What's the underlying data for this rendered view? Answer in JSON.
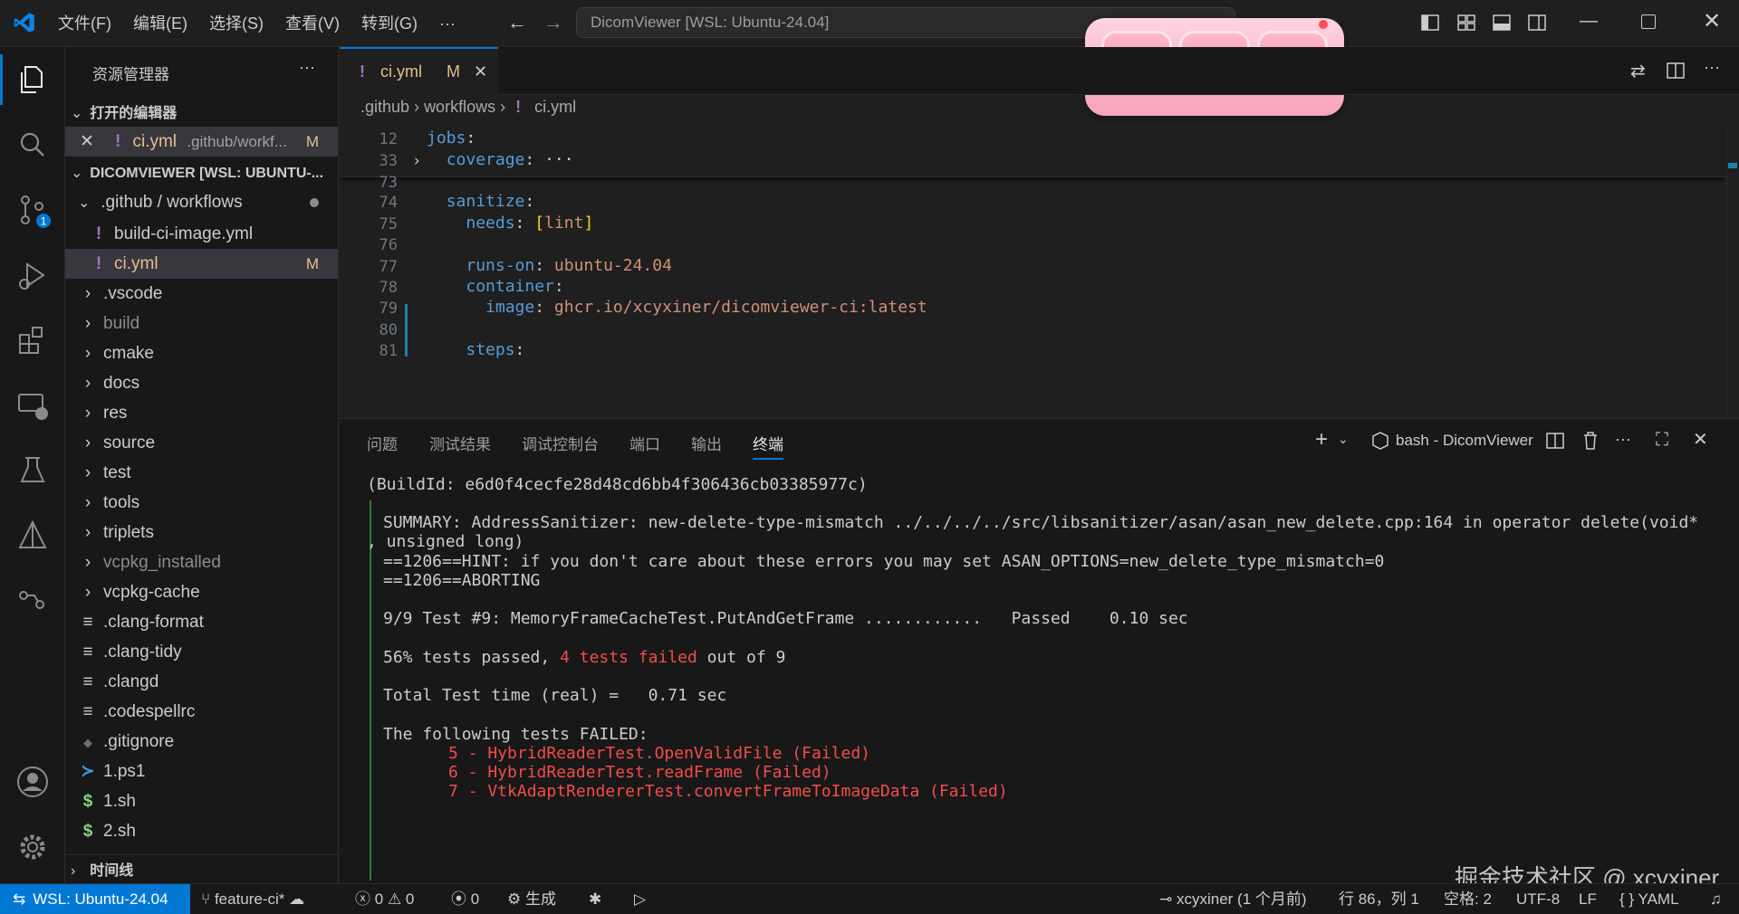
{
  "menu": [
    "文件(F)",
    "编辑(E)",
    "选择(S)",
    "查看(V)",
    "转到(G)",
    "···"
  ],
  "window_title": "DicomViewer [WSL: Ubuntu-24.04]",
  "sidebar": {
    "title": "资源管理器",
    "open_editors_label": "打开的编辑器",
    "open_editor": {
      "name": "ci.yml",
      "path": ".github/workf...",
      "status": "M"
    },
    "workspace_label": "DICOMVIEWER [WSL: UBUNTU-...",
    "github_folder": ".github / workflows",
    "items": [
      {
        "name": "build-ci-image.yml",
        "icon": "!",
        "indent": 2
      },
      {
        "name": "ci.yml",
        "icon": "!",
        "indent": 2,
        "status": "M"
      },
      {
        "name": ".vscode",
        "icon": "chevron"
      },
      {
        "name": "build",
        "icon": "chevron",
        "dim": true
      },
      {
        "name": "cmake",
        "icon": "chevron"
      },
      {
        "name": "docs",
        "icon": "chevron"
      },
      {
        "name": "res",
        "icon": "chevron"
      },
      {
        "name": "source",
        "icon": "chevron"
      },
      {
        "name": "test",
        "icon": "chevron"
      },
      {
        "name": "tools",
        "icon": "chevron"
      },
      {
        "name": "triplets",
        "icon": "chevron"
      },
      {
        "name": "vcpkg_installed",
        "icon": "chevron",
        "dim": true
      },
      {
        "name": "vcpkg-cache",
        "icon": "chevron"
      },
      {
        "name": ".clang-format",
        "icon": "≡"
      },
      {
        "name": ".clang-tidy",
        "icon": "≡"
      },
      {
        "name": ".clangd",
        "icon": "≡"
      },
      {
        "name": ".codespellrc",
        "icon": "≡"
      },
      {
        "name": ".gitignore",
        "icon": "◆"
      },
      {
        "name": "1.ps1",
        "icon": ">_"
      },
      {
        "name": "1.sh",
        "icon": "$"
      },
      {
        "name": "2.sh",
        "icon": "$"
      }
    ],
    "timeline_label": "时间线"
  },
  "tab": {
    "name": "ci.yml",
    "status": "M"
  },
  "breadcrumb": [
    ".github",
    "workflows",
    "ci.yml"
  ],
  "editor": {
    "lines": [
      {
        "n": "12",
        "text": "jobs:"
      },
      {
        "n": "33",
        "text": "  coverage: ···"
      },
      {
        "n": "73",
        "text": ""
      },
      {
        "n": "74",
        "text": "  sanitize:"
      },
      {
        "n": "75",
        "text": "    needs: [lint]"
      },
      {
        "n": "76",
        "text": ""
      },
      {
        "n": "77",
        "text": "    runs-on: ubuntu-24.04"
      },
      {
        "n": "78",
        "text": "    container:"
      },
      {
        "n": "79",
        "text": "      image: ghcr.io/xcyxiner/dicomviewer-ci:latest"
      },
      {
        "n": "80",
        "text": ""
      },
      {
        "n": "81",
        "text": "    steps:"
      }
    ]
  },
  "panel": {
    "tabs": [
      "问题",
      "测试结果",
      "调试控制台",
      "端口",
      "输出",
      "终端"
    ],
    "active_tab": "终端",
    "terminal_name": "bash - DicomViewer",
    "terminal": {
      "build_id": "(BuildId: e6d0f4cecfe28d48cd6bb4f306436cb03385977c)",
      "summary": "SUMMARY: AddressSanitizer: new-delete-type-mismatch ../../../../src/libsanitizer/asan/asan_new_delete.cpp:164 in operator delete(void*",
      "summary_cont": ", unsigned long)",
      "hint": "==1206==HINT: if you don't care about these errors you may set ASAN_OPTIONS=new_delete_type_mismatch=0",
      "abort": "==1206==ABORTING",
      "test9": "9/9 Test #9: MemoryFrameCacheTest.PutAndGetFrame ............   Passed    0.10 sec",
      "pass_pct": "56% tests passed, ",
      "failed": "4 tests failed",
      "out_of": " out of 9",
      "total_time": "Total Test time (real) =   0.71 sec",
      "following": "The following tests FAILED:",
      "failures": [
        "5 - HybridReaderTest.OpenValidFile (Failed)",
        "6 - HybridReaderTest.readFrame (Failed)",
        "7 - VtkAdaptRendererTest.convertFrameToImageData (Failed)"
      ]
    }
  },
  "statusbar": {
    "remote": "WSL: Ubuntu-24.04",
    "branch": "feature-ci*",
    "errors": "0",
    "warnings": "0",
    "ports": "0",
    "build": "生成",
    "author": "xcyxiner (1 个月前)",
    "position": "行 86，列 1",
    "spaces": "空格: 2",
    "encoding": "UTF-8",
    "eol": "LF",
    "language": "YAML"
  },
  "watermark": "掘金技术社区 @ xcyxiner",
  "colors": {
    "accent": "#0078d4",
    "modified": "#e2c08d",
    "error": "#f14c4c",
    "keyword": "#569cd6",
    "string": "#ce9178"
  }
}
